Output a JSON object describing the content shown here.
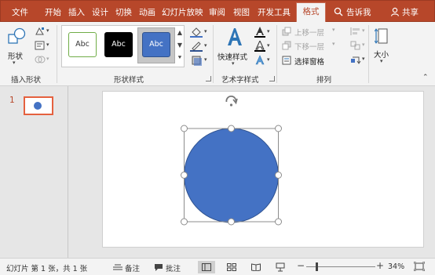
{
  "tabs": [
    "文件",
    "开始",
    "插入",
    "设计",
    "切换",
    "动画",
    "幻灯片放映",
    "审阅",
    "视图",
    "开发工具",
    "格式"
  ],
  "tell_me": "告诉我",
  "share": "共享",
  "ribbon": {
    "insert_shapes": {
      "shapes_button": "形状",
      "label": "插入形状"
    },
    "shape_styles": {
      "samples": [
        "Abc",
        "Abc",
        "Abc"
      ],
      "label": "形状样式"
    },
    "wordart": {
      "quick_styles": "快速样式",
      "label": "艺术字样式"
    },
    "arrange": {
      "bring_forward": "上移一层",
      "send_backward": "下移一层",
      "selection_pane": "选择窗格",
      "label": "排列"
    },
    "size": {
      "label": "大小"
    }
  },
  "thumbnail": {
    "number": "1"
  },
  "status": {
    "slide_info": "幻灯片 第 1 张，共 1 张",
    "notes": "备注",
    "comments": "批注",
    "zoom": "34%"
  },
  "colors": {
    "accent": "#b7472a",
    "shape_fill": "#4472c4",
    "thumb_border": "#e5613f"
  }
}
